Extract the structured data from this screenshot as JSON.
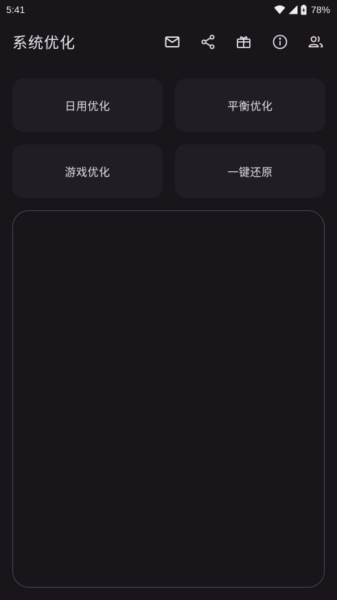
{
  "status_bar": {
    "time": "5:41",
    "battery_percent": "78%",
    "icons": [
      "wifi-icon",
      "cell-signal-icon",
      "battery-charging-icon"
    ]
  },
  "app_bar": {
    "title": "系统优化",
    "actions": [
      "mail-icon",
      "share-icon",
      "gift-icon",
      "info-icon",
      "people-icon"
    ]
  },
  "buttons": {
    "daily": "日用优化",
    "balanced": "平衡优化",
    "game": "游戏优化",
    "restore": "一键还原"
  },
  "colors": {
    "background": "#1a141b",
    "button_bg": "#221d24",
    "panel_border": "#4e4851",
    "text": "#e3dde4"
  }
}
